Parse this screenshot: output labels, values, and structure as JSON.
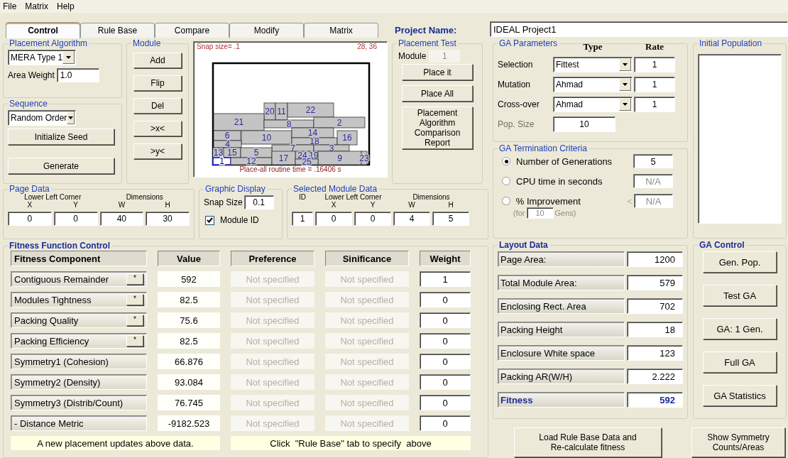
{
  "menu": [
    "File",
    "Matrix",
    "Help"
  ],
  "tabs": [
    {
      "label": "Control",
      "selected": true
    },
    {
      "label": "Rule Base",
      "selected": false
    },
    {
      "label": "Compare",
      "selected": false
    },
    {
      "label": "Modify",
      "selected": false
    },
    {
      "label": "Matrix",
      "selected": false
    }
  ],
  "project": {
    "label": "Project Name:",
    "value": "IDEAL Project1"
  },
  "placement_algorithm": {
    "title": "Placement Algorithm",
    "algorithm": "MERA Type 1",
    "area_weight_label": "Area Weight",
    "area_weight": "1.0"
  },
  "sequence": {
    "title": "Sequence",
    "order": "Random Order",
    "buttons": [
      "Initialize Seed",
      "Generate"
    ]
  },
  "module": {
    "title": "Module",
    "buttons": [
      "Add",
      "Flip",
      "Del",
      ">x<",
      ">y<"
    ]
  },
  "canvas": {
    "snap_text": "Snap size= .1",
    "cursor": "28, 36",
    "routine_time": "Place-all routine time = .16406 s",
    "modules": [
      {
        "id": "20",
        "selected": false
      },
      {
        "id": "11",
        "selected": false
      },
      {
        "id": "22",
        "selected": false
      },
      {
        "id": "21",
        "selected": false
      },
      {
        "id": "8",
        "selected": false
      },
      {
        "id": "2",
        "selected": false
      },
      {
        "id": "6",
        "selected": false
      },
      {
        "id": "10",
        "selected": false
      },
      {
        "id": "14",
        "selected": false
      },
      {
        "id": "18",
        "selected": false
      },
      {
        "id": "16",
        "selected": false
      },
      {
        "id": "4",
        "selected": false
      },
      {
        "id": "7",
        "selected": false
      },
      {
        "id": "3",
        "selected": false
      },
      {
        "id": "13",
        "selected": false
      },
      {
        "id": "15",
        "selected": false
      },
      {
        "id": "5",
        "selected": false
      },
      {
        "id": "24",
        "selected": false
      },
      {
        "id": "19",
        "selected": false
      },
      {
        "id": "9",
        "selected": false
      },
      {
        "id": "23",
        "selected": false
      },
      {
        "id": "1",
        "selected": true
      },
      {
        "id": "12",
        "selected": false
      },
      {
        "id": "17",
        "selected": false
      },
      {
        "id": "25",
        "selected": false
      }
    ]
  },
  "placement_test": {
    "title": "Placement Test",
    "module_label": "Module",
    "module_value": "1",
    "module_disabled": true,
    "buttons": [
      "Place it",
      "Place All",
      "Placement Algorithm Comparison Report"
    ]
  },
  "ga_parameters": {
    "title": "GA Parameters",
    "type_header": "Type",
    "rate_header": "Rate",
    "rows": [
      {
        "label": "Selection",
        "type": "Fittest",
        "rate": "1"
      },
      {
        "label": "Mutation",
        "type": "Ahmad",
        "rate": "1"
      },
      {
        "label": "Cross-over",
        "type": "Ahmad",
        "rate": "1"
      }
    ],
    "pop_size_label": "Pop. Size",
    "pop_size": "10"
  },
  "termination": {
    "title": "GA Termination Criteria",
    "options": [
      {
        "label": "Number of Generations",
        "selected": true,
        "value": "5"
      },
      {
        "label": "CPU time in seconds",
        "selected": false,
        "value": "N/A"
      },
      {
        "label": "% Improvement",
        "selected": false,
        "sign": "<",
        "value": "N/A",
        "note": {
          "prefix": "(for",
          "value": "10",
          "suffix": "Gens)"
        }
      }
    ]
  },
  "initial_population": {
    "title": "Initial Population"
  },
  "page_data": {
    "title": "Page Data",
    "corner_label": "Lower Left Corner",
    "dims_label": "Dimensions",
    "axes": [
      "X",
      "Y",
      "W",
      "H"
    ],
    "values": [
      "0",
      "0",
      "40",
      "30"
    ]
  },
  "graphic_display": {
    "title": "Graphic Display",
    "snap_label": "Snap Size",
    "snap_value": "0.1",
    "module_id_label": "Module ID",
    "module_id_checked": true
  },
  "selected_module": {
    "title": "Selected Module Data",
    "id_label": "ID",
    "corner_label": "Lower Left Corner",
    "dims_label": "Dimensions",
    "axes": [
      "X",
      "Y",
      "W",
      "H"
    ],
    "values": [
      "1",
      "0",
      "0",
      "4",
      "5"
    ]
  },
  "fitness": {
    "title": "Fitness Function Control",
    "columns": [
      "Fitness Component",
      "Value",
      "Preference",
      "Sinificance",
      "Weight"
    ],
    "rows": [
      {
        "kind": "toggle",
        "component": "Contiguous Remainder",
        "button": "*",
        "value": "592",
        "preference": "Not specified",
        "significance": "Not specified",
        "weight": "1"
      },
      {
        "kind": "toggle",
        "component": "Modules Tightness",
        "button": "*",
        "value": "82.5",
        "preference": "Not specified",
        "significance": "Not specified",
        "weight": "0"
      },
      {
        "kind": "toggle",
        "component": "Packing Quality",
        "button": "*",
        "value": "75.6",
        "preference": "Not specified",
        "significance": "Not specified",
        "weight": "0"
      },
      {
        "kind": "toggle",
        "component": "Packing Efficiency",
        "button": "*",
        "value": "82.5",
        "preference": "Not specified",
        "significance": "Not specified",
        "weight": "0"
      },
      {
        "kind": "plain",
        "component": "Symmetry1 (Cohesion)",
        "value": "66.876",
        "preference": "Not specified",
        "significance": "Not specified",
        "weight": "0"
      },
      {
        "kind": "plain",
        "component": "Symmetry2 (Density)",
        "value": "93.084",
        "preference": "Not specified",
        "significance": "Not specified",
        "weight": "0"
      },
      {
        "kind": "plain",
        "component": "Symmetry3 (Distrib/Count)",
        "value": "76.745",
        "preference": "Not specified",
        "significance": "Not specified",
        "weight": "0"
      },
      {
        "kind": "plain",
        "component": "- Distance Metric",
        "value": "-9182.523",
        "preference": "Not specified",
        "significance": "Not specified",
        "weight": "0"
      }
    ],
    "notes": [
      "A new placement updates above data.",
      "Click  \"Rule Base\" tab to specify  above"
    ]
  },
  "layout_data": {
    "title": "Layout Data",
    "rows": [
      {
        "kind": "normal",
        "label": "Page Area:",
        "value": "1200"
      },
      {
        "kind": "normal",
        "label": "Total Module Area:",
        "value": "579"
      },
      {
        "kind": "normal",
        "label": "Enclosing Rect. Area",
        "value": "702"
      },
      {
        "kind": "normal",
        "label": "Packing Height",
        "value": "18"
      },
      {
        "kind": "normal",
        "label": "Enclosure White space",
        "value": "123"
      },
      {
        "kind": "normal",
        "label": "Packing AR(W/H)",
        "value": "2.222"
      },
      {
        "kind": "total",
        "label": "Fitness",
        "value": "592"
      }
    ]
  },
  "ga_control": {
    "title": "GA Control",
    "buttons": [
      "Gen. Pop.",
      "Test GA",
      "GA: 1 Gen.",
      "Full GA",
      "GA Statistics"
    ]
  },
  "bottom_buttons": [
    "Load Rule Base Data and Re-calculate fitness",
    "Show Symmetry Counts/Areas"
  ]
}
